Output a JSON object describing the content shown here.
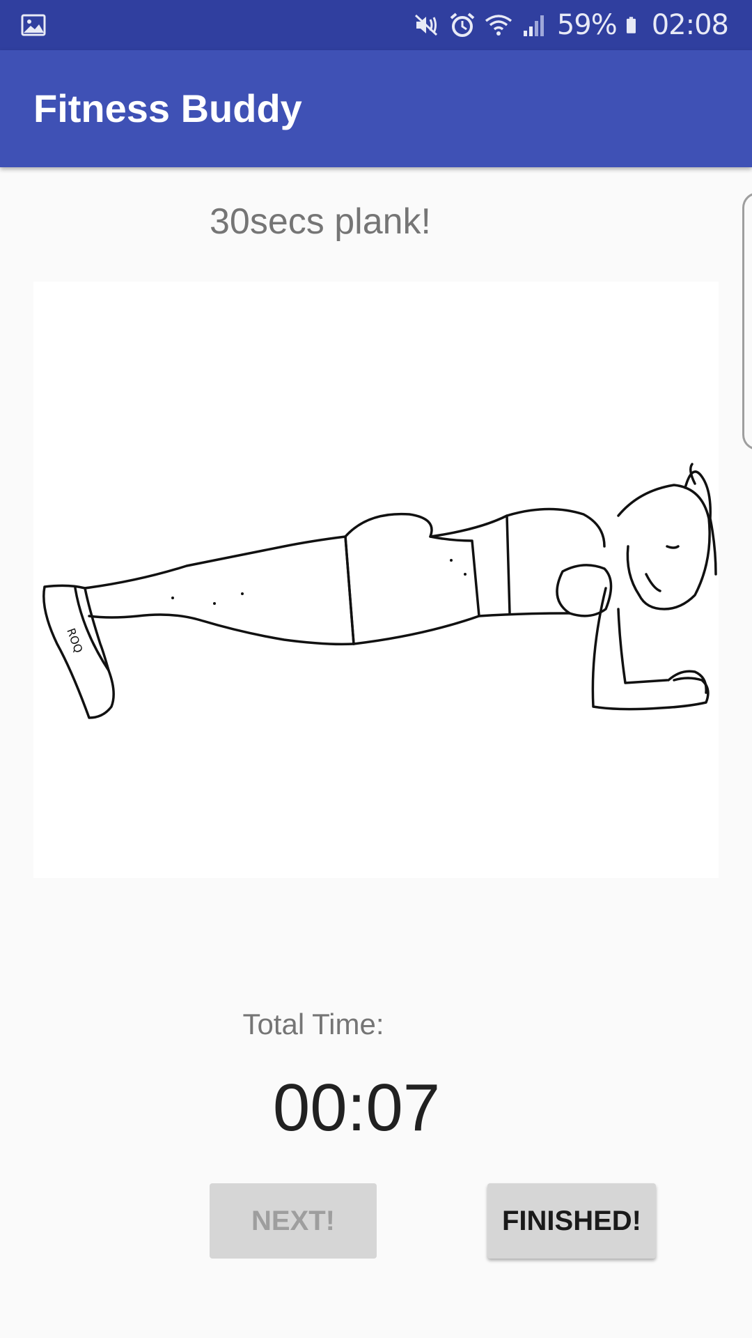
{
  "status_bar": {
    "battery": "59%",
    "time": "02:08",
    "icons": [
      "gallery-notification-icon",
      "vibrate-mute-icon",
      "alarm-icon",
      "wifi-icon",
      "signal-icon",
      "battery-icon"
    ]
  },
  "app_bar": {
    "title": "Fitness Buddy",
    "color": "#3f51b5"
  },
  "exercise": {
    "title": "30secs plank!",
    "image_alt": "plank-illustration"
  },
  "timer": {
    "label": "Total Time:",
    "value": "00:07"
  },
  "buttons": {
    "next": "NEXT!",
    "finished": "FINISHED!"
  },
  "colors": {
    "status_bar": "#303f9f",
    "primary": "#3f51b5",
    "background": "#fafafa",
    "button": "#d6d6d6"
  }
}
